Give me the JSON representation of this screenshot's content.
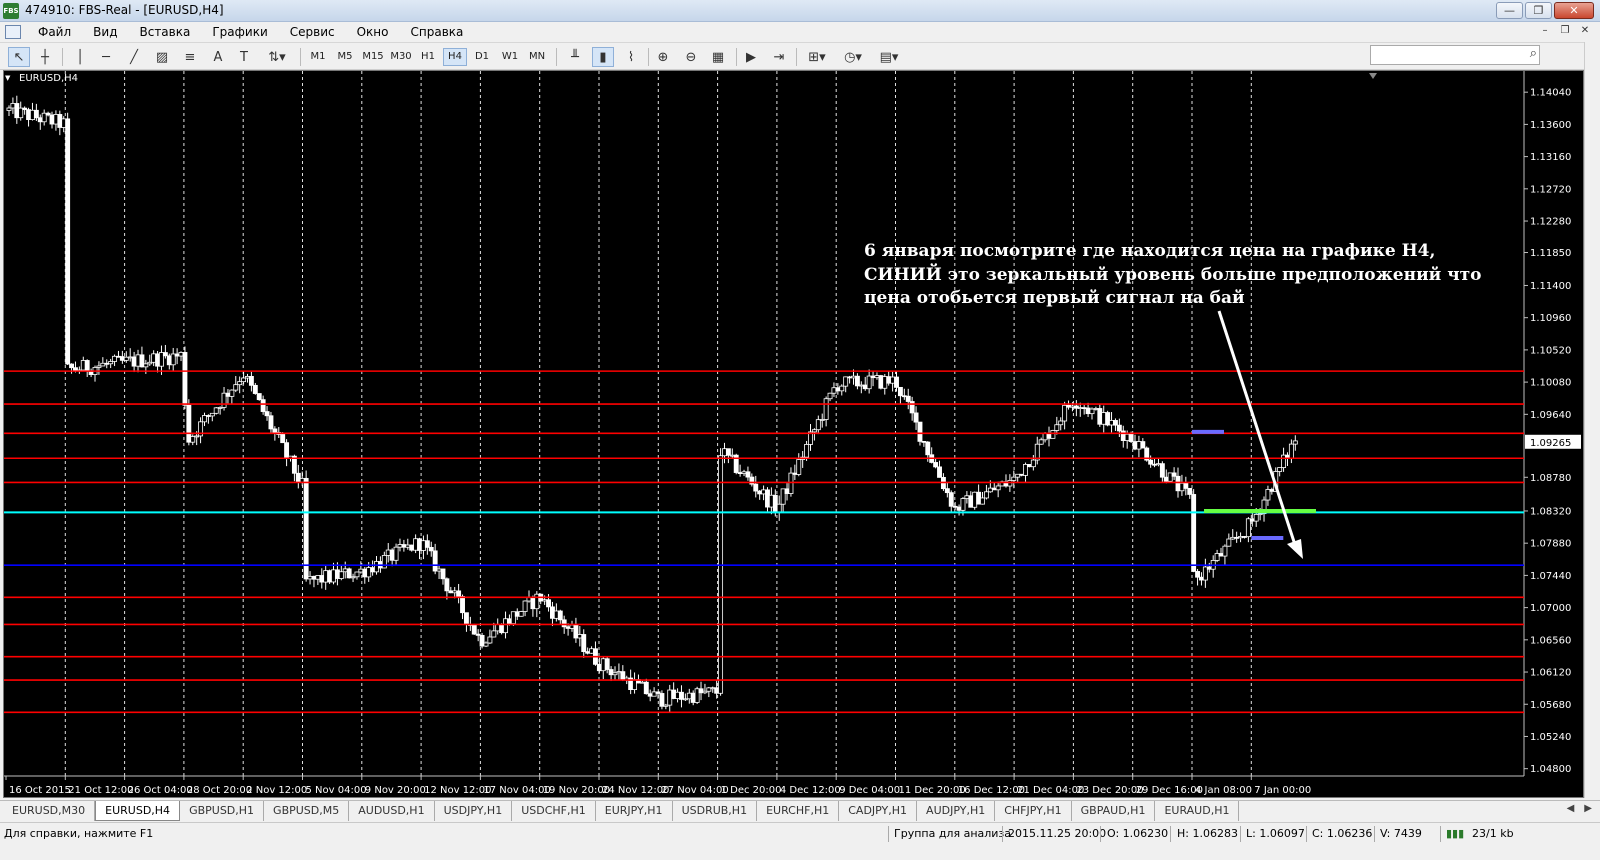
{
  "window": {
    "title": "474910: FBS-Real - [EURUSD,H4]",
    "app_icon_text": "FBS"
  },
  "menu": [
    "Файл",
    "Вид",
    "Вставка",
    "Графики",
    "Сервис",
    "Окно",
    "Справка"
  ],
  "toolbar": {
    "timeframes": [
      "M1",
      "M5",
      "M15",
      "M30",
      "H1",
      "H4",
      "D1",
      "W1",
      "MN"
    ],
    "selected_timeframe": "H4",
    "tools": [
      "cursor-icon",
      "crosshair-icon",
      "vertical-line-icon",
      "horizontal-line-icon",
      "trendline-icon",
      "channel-icon",
      "fibonacci-icon",
      "text-icon",
      "text-label-icon",
      "arrows-icon",
      "bar-chart-icon",
      "candles-icon",
      "line-chart-icon",
      "zoom-in-icon",
      "zoom-out-icon",
      "tile-icon",
      "autoscroll-icon",
      "chart-shift-icon",
      "indicators-icon",
      "periods-icon",
      "templates-icon"
    ]
  },
  "search": {
    "placeholder": ""
  },
  "chart": {
    "symbol_label": "EURUSD,H4",
    "annotation": [
      "6 января посмотрите где находится цена на графике Н4,",
      "СИНИЙ это зеркальный уровень больше предположений что",
      "цена отобьется первый сигнал на бай"
    ],
    "colors": {
      "background": "#000000",
      "candle": "#ffffff",
      "resistance": "#ff0000",
      "mirror_level": "#0000ff",
      "cyan_level": "#00ffff",
      "arrow": "#ffffff"
    }
  },
  "chart_data": {
    "type": "candlestick",
    "symbol": "EURUSD",
    "timeframe": "H4",
    "y_ticks": [
      1.1404,
      1.136,
      1.1316,
      1.1272,
      1.1228,
      1.1185,
      1.114,
      1.1096,
      1.1052,
      1.1008,
      1.0964,
      1.0878,
      1.0832,
      1.0788,
      1.0744,
      1.07,
      1.0656,
      1.0612,
      1.0568,
      1.0524,
      1.048
    ],
    "current_price": 1.09265,
    "x_ticks": [
      "16 Oct 2015",
      "21 Oct 12:00",
      "26 Oct 04:00",
      "28 Oct 20:00",
      "2 Nov 12:00",
      "5 Nov 04:00",
      "9 Nov 20:00",
      "12 Nov 12:00",
      "17 Nov 04:00",
      "19 Nov 20:00",
      "24 Nov 12:00",
      "27 Nov 04:00",
      "1 Dec 20:00",
      "4 Dec 12:00",
      "9 Dec 04:00",
      "11 Dec 20:00",
      "16 Dec 12:00",
      "21 Dec 04:00",
      "23 Dec 20:00",
      "29 Dec 16:00",
      "4 Jan 08:00",
      "7 Jan 00:00"
    ],
    "levels": [
      {
        "price": 1.1023,
        "color": "#ff0000"
      },
      {
        "price": 1.0978,
        "color": "#ff0000"
      },
      {
        "price": 1.0938,
        "color": "#ff0000"
      },
      {
        "price": 1.0904,
        "color": "#ff0000"
      },
      {
        "price": 1.0871,
        "color": "#ff0000"
      },
      {
        "price": 1.083,
        "color": "#00ffff"
      },
      {
        "price": 1.0758,
        "color": "#0000ff"
      },
      {
        "price": 1.0714,
        "color": "#ff0000"
      },
      {
        "price": 1.0677,
        "color": "#ff0000"
      },
      {
        "price": 1.0633,
        "color": "#ff0000"
      },
      {
        "price": 1.0601,
        "color": "#ff0000"
      },
      {
        "price": 1.0557,
        "color": "#ff0000"
      }
    ],
    "short_levels": [
      {
        "price": 1.094,
        "from": "4 Jan 08:00",
        "color": "#6a6aff"
      },
      {
        "price": 1.0832,
        "from": "4 Jan 08:00",
        "color": "#66ff44"
      },
      {
        "price": 1.0795,
        "from": "7 Jan 00:00",
        "color": "#6a6aff"
      }
    ],
    "price_path": [
      [
        "16 Oct 2015",
        1.138
      ],
      [
        "21 Oct 12:00",
        1.136
      ],
      [
        "21 Oct 12:00",
        1.1025
      ],
      [
        "26 Oct 04:00",
        1.1035
      ],
      [
        "28 Oct 20:00",
        1.1045
      ],
      [
        "28 Oct 20:00",
        1.0925
      ],
      [
        "2 Nov 12:00",
        1.102
      ],
      [
        "5 Nov 04:00",
        1.0865
      ],
      [
        "5 Nov 04:00",
        1.0735
      ],
      [
        "9 Nov 20:00",
        1.075
      ],
      [
        "12 Nov 12:00",
        1.079
      ],
      [
        "17 Nov 04:00",
        1.0655
      ],
      [
        "19 Nov 20:00",
        1.0715
      ],
      [
        "24 Nov 12:00",
        1.0625
      ],
      [
        "27 Nov 04:00",
        1.0575
      ],
      [
        "1 Dec 20:00",
        1.0585
      ],
      [
        "1 Dec 20:00",
        1.0915
      ],
      [
        "4 Dec 12:00",
        1.0835
      ],
      [
        "9 Dec 04:00",
        1.1005
      ],
      [
        "11 Dec 20:00",
        1.101
      ],
      [
        "16 Dec 12:00",
        1.0835
      ],
      [
        "21 Dec 04:00",
        1.0875
      ],
      [
        "23 Dec 20:00",
        1.0985
      ],
      [
        "29 Dec 16:00",
        1.093
      ],
      [
        "4 Jan 08:00",
        1.0845
      ],
      [
        "4 Jan 08:00",
        1.0735
      ],
      [
        "7 Jan 00:00",
        1.0815
      ],
      [
        "7 Jan 00:00",
        1.0935
      ]
    ]
  },
  "tabs": [
    "EURUSD,M30",
    "EURUSD,H4",
    "GBPUSD,H1",
    "GBPUSD,M5",
    "AUDUSD,H1",
    "USDJPY,H1",
    "USDCHF,H1",
    "EURJPY,H1",
    "USDRUB,H1",
    "EURCHF,H1",
    "CADJPY,H1",
    "AUDJPY,H1",
    "CHFJPY,H1",
    "GBPAUD,H1",
    "EURAUD,H1"
  ],
  "active_tab": "EURUSD,H4",
  "status": {
    "help": "Для справки, нажмите F1",
    "profile": "Группа для анализа",
    "datetime": "2015.11.25 20:00",
    "open": "O: 1.06230",
    "high": "H: 1.06283",
    "low": "L: 1.06097",
    "close": "C: 1.06236",
    "volume": "V: 7439",
    "traffic": "23/1 kb"
  }
}
